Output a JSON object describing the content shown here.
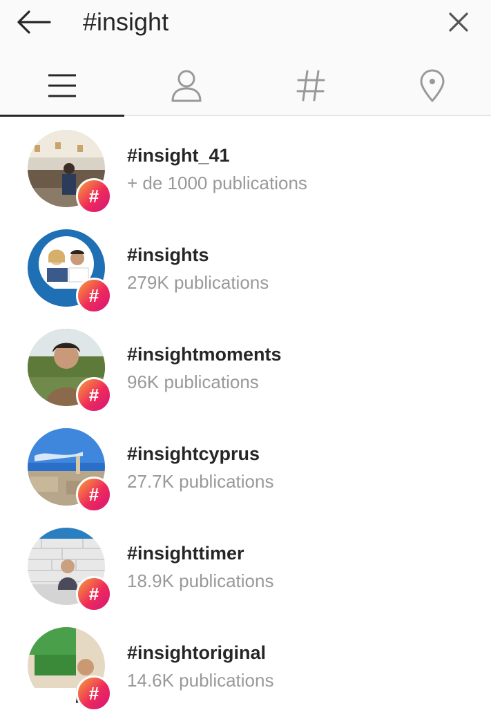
{
  "search": {
    "query": "#insight"
  },
  "tabs": [
    {
      "name": "top",
      "icon": "menu-lines-icon"
    },
    {
      "name": "accounts",
      "icon": "person-icon"
    },
    {
      "name": "tags",
      "icon": "hashtag-icon"
    },
    {
      "name": "places",
      "icon": "location-pin-icon"
    }
  ],
  "badge_symbol": "#",
  "colors": {
    "accent_gradient": [
      "#f7a03a",
      "#ee2a5a",
      "#d4157c"
    ],
    "secondary_text": "#999999",
    "primary_text": "#262626"
  },
  "results": [
    {
      "name": "#insight_41",
      "count": "+ de 1000 publications"
    },
    {
      "name": "#insights",
      "count": "279K publications"
    },
    {
      "name": "#insightmoments",
      "count": "96K publications"
    },
    {
      "name": "#insightcyprus",
      "count": "27.7K publications"
    },
    {
      "name": "#insighttimer",
      "count": "18.9K publications"
    },
    {
      "name": "#insightoriginal",
      "count": "14.6K publications"
    }
  ]
}
